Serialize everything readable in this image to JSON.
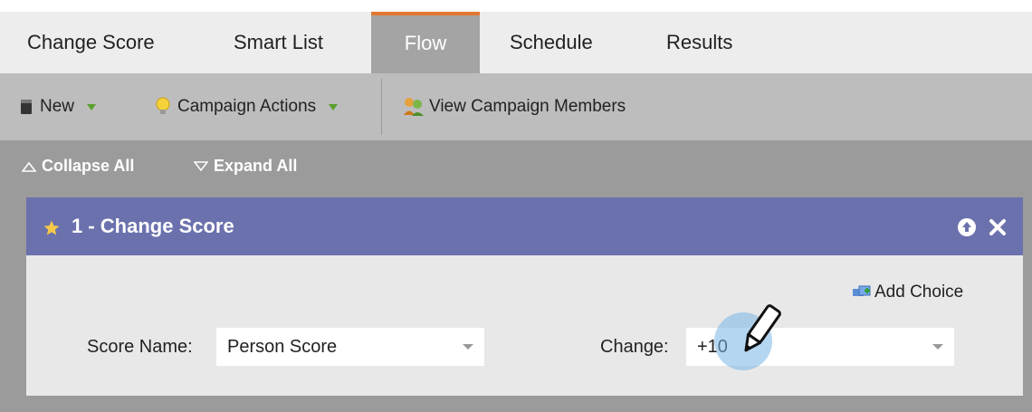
{
  "tabs": [
    {
      "label": "Change Score"
    },
    {
      "label": "Smart List"
    },
    {
      "label": "Flow"
    },
    {
      "label": "Schedule"
    },
    {
      "label": "Results"
    }
  ],
  "toolbar": {
    "new_label": "New",
    "campaign_actions_label": "Campaign Actions",
    "view_members_label": "View Campaign Members"
  },
  "subbar": {
    "collapse_label": "Collapse All",
    "expand_label": "Expand All"
  },
  "step": {
    "title": "1 - Change Score",
    "add_choice_label": "Add Choice",
    "score_name_label": "Score Name:",
    "score_name_value": "Person Score",
    "change_label": "Change:",
    "change_value": "+10"
  },
  "colors": {
    "active_tab_accent": "#e2772f",
    "panel_header": "#6b71ad"
  }
}
